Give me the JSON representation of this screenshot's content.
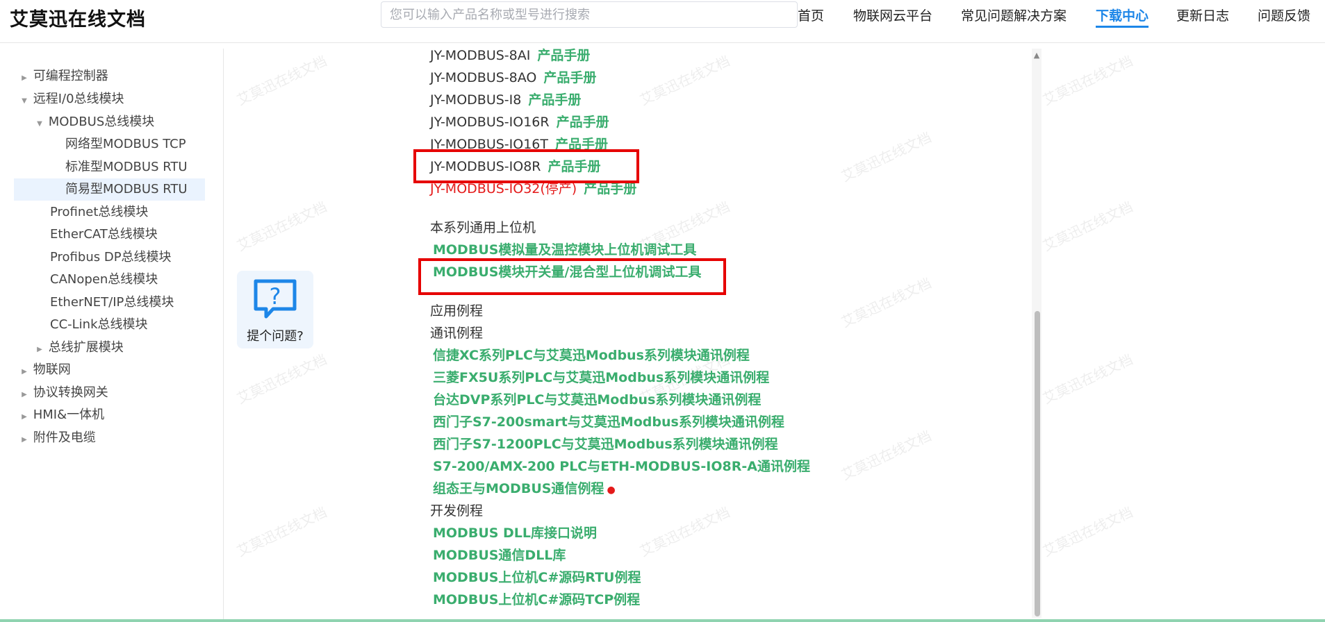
{
  "header": {
    "logo": "艾莫迅在线文档",
    "search_placeholder": "您可以输入产品名称或型号进行搜索",
    "nav": [
      {
        "label": "首页",
        "active": false
      },
      {
        "label": "物联网云平台",
        "active": false
      },
      {
        "label": "常见问题解决方案",
        "active": false
      },
      {
        "label": "下载中心",
        "active": true
      },
      {
        "label": "更新日志",
        "active": false
      },
      {
        "label": "问题反馈",
        "active": false
      }
    ]
  },
  "sidebar": {
    "items": [
      {
        "label": "可编程控制器",
        "arrow": "▶"
      },
      {
        "label": "远程I/0总线模块",
        "arrow": "▼"
      },
      {
        "label": "MODBUS总线模块",
        "arrow": "▼"
      },
      {
        "label": "网络型MODBUS TCP",
        "arrow": ""
      },
      {
        "label": "标准型MODBUS RTU",
        "arrow": ""
      },
      {
        "label": "简易型MODBUS RTU",
        "arrow": ""
      },
      {
        "label": "Profinet总线模块",
        "arrow": ""
      },
      {
        "label": "EtherCAT总线模块",
        "arrow": ""
      },
      {
        "label": "Profibus DP总线模块",
        "arrow": ""
      },
      {
        "label": "CANopen总线模块",
        "arrow": ""
      },
      {
        "label": "EtherNET/IP总线模块",
        "arrow": ""
      },
      {
        "label": "CC-Link总线模块",
        "arrow": ""
      },
      {
        "label": "总线扩展模块",
        "arrow": "▶"
      },
      {
        "label": "物联网",
        "arrow": "▶"
      },
      {
        "label": "协议转换网关",
        "arrow": "▶"
      },
      {
        "label": "HMI&一体机",
        "arrow": "▶"
      },
      {
        "label": "附件及电缆",
        "arrow": "▶"
      }
    ]
  },
  "help": {
    "label": "提个问题?"
  },
  "content": {
    "models": [
      {
        "name": "JY-MODBUS-8AI",
        "link": "产品手册"
      },
      {
        "name": "JY-MODBUS-8AO",
        "link": "产品手册"
      },
      {
        "name": "JY-MODBUS-I8",
        "link": "产品手册"
      },
      {
        "name": "JY-MODBUS-IO16R",
        "link": "产品手册"
      },
      {
        "name": "JY-MODBUS-IO16T",
        "link": "产品手册"
      },
      {
        "name": "JY-MODBUS-IO8R",
        "link": "产品手册"
      },
      {
        "name": "JY-MODBUS-IO32(停产)",
        "link": "产品手册"
      }
    ],
    "host_section": "本系列通用上位机",
    "host_links": [
      "MODBUS模拟量及温控模块上位机调试工具",
      "MODBUS模块开关量/混合型上位机调试工具"
    ],
    "app_section": "应用例程",
    "comm_section": "通讯例程",
    "comm_links": [
      "信捷XC系列PLC与艾莫迅Modbus系列模块通讯例程",
      "三菱FX5U系列PLC与艾莫迅Modbus系列模块通讯例程",
      "台达DVP系列PLC与艾莫迅Modbus系列模块通讯例程",
      "西门子S7-200smart与艾莫迅Modbus系列模块通讯例程",
      "西门子S7-1200PLC与艾莫迅Modbus系列模块通讯例程",
      "S7-200/AMX-200 PLC与ETH-MODBUS-IO8R-A通讯例程",
      "组态王与MODBUS通信例程"
    ],
    "dev_section": "开发例程",
    "dev_links": [
      "MODBUS DLL库接口说明",
      "MODBUS通信DLL库",
      "MODBUS上位机C#源码RTU例程",
      "MODBUS上位机C#源码TCP例程"
    ]
  },
  "watermark": "艾莫迅在线文档",
  "colors": {
    "link_green": "#3aad6e",
    "nav_active": "#1d86e8",
    "highlight_red": "#e60000",
    "discontinued_red": "#e41a1a"
  }
}
